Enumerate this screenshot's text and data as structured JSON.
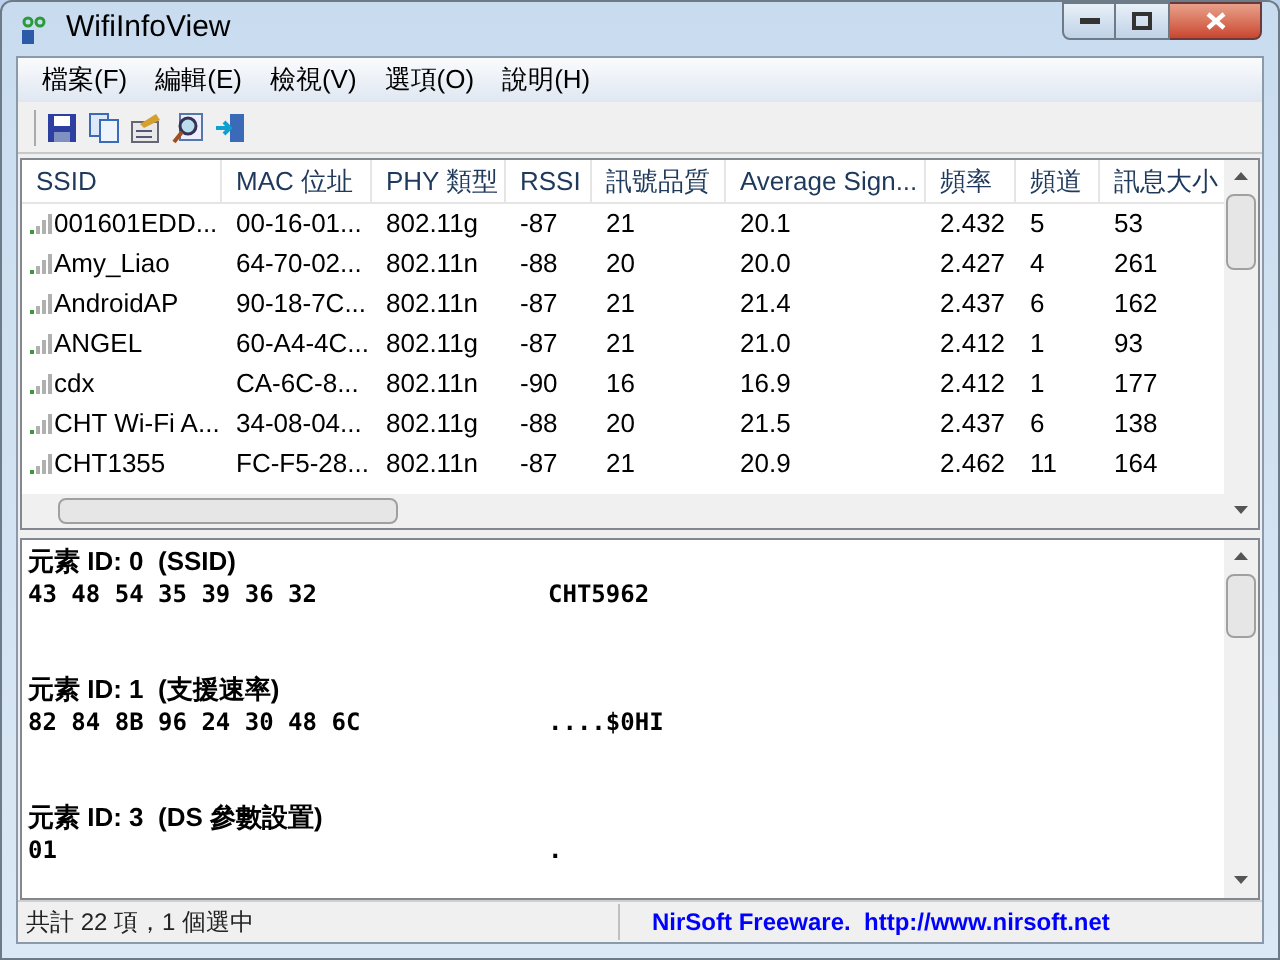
{
  "window": {
    "title": "WifiInfoView"
  },
  "menu": [
    "檔案(F)",
    "編輯(E)",
    "檢視(V)",
    "選項(O)",
    "說明(H)"
  ],
  "table": {
    "columns": [
      "SSID",
      "MAC 位址",
      "PHY 類型",
      "RSSI",
      "訊號品質",
      "Average Sign...",
      "頻率",
      "頻道",
      "訊息大小"
    ],
    "rows": [
      [
        "001601EDD...",
        "00-16-01...",
        "802.11g",
        "-87",
        "21",
        "20.1",
        "2.432",
        "5",
        "53"
      ],
      [
        "Amy_Liao",
        "64-70-02...",
        "802.11n",
        "-88",
        "20",
        "20.0",
        "2.427",
        "4",
        "261"
      ],
      [
        "AndroidAP",
        "90-18-7C...",
        "802.11n",
        "-87",
        "21",
        "21.4",
        "2.437",
        "6",
        "162"
      ],
      [
        "ANGEL",
        "60-A4-4C...",
        "802.11g",
        "-87",
        "21",
        "21.0",
        "2.412",
        "1",
        "93"
      ],
      [
        "cdx",
        "CA-6C-8...",
        "802.11n",
        "-90",
        "16",
        "16.9",
        "2.412",
        "1",
        "177"
      ],
      [
        "CHT Wi-Fi A...",
        "34-08-04...",
        "802.11g",
        "-88",
        "20",
        "21.5",
        "2.437",
        "6",
        "138"
      ],
      [
        "CHT1355",
        "FC-F5-28...",
        "802.11n",
        "-87",
        "21",
        "20.9",
        "2.462",
        "11",
        "164"
      ]
    ]
  },
  "details": [
    {
      "title": "元素 ID: 0  (SSID)",
      "hex": "43 48 54 35 39 36 32",
      "ascii": "CHT5962"
    },
    {
      "title": "元素 ID: 1  (支援速率)",
      "hex": "82 84 8B 96 24 30 48 6C",
      "ascii": "....$0HI"
    },
    {
      "title": "元素 ID: 3  (DS 參數設置)",
      "hex": "01",
      "ascii": "."
    }
  ],
  "status_bar": {
    "count": "共計 22 項，1 個選中",
    "link": "NirSoft Freeware.  http://www.nirsoft.net"
  }
}
